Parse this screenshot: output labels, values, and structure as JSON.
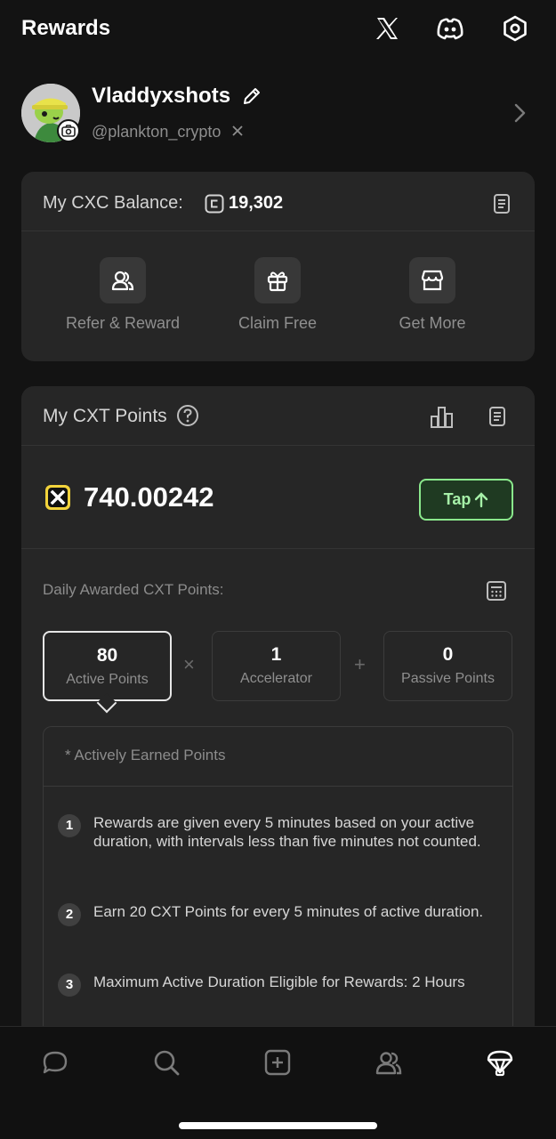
{
  "header": {
    "title": "Rewards",
    "icons": [
      "x-logo-icon",
      "discord-icon",
      "settings-hex-icon"
    ]
  },
  "profile": {
    "display_name": "Vladdyxshots",
    "handle": "@plankton_crypto"
  },
  "balance": {
    "label": "My CXC Balance:",
    "value": "19,302",
    "actions": [
      {
        "label": "Refer & Reward",
        "icon": "users-icon"
      },
      {
        "label": "Claim Free",
        "icon": "gift-icon"
      },
      {
        "label": "Get More",
        "icon": "store-icon"
      }
    ]
  },
  "points": {
    "title": "My CXT Points",
    "value": "740.00242",
    "tap_label": "Tap",
    "daily_label": "Daily Awarded CXT Points:",
    "metrics": [
      {
        "value": "80",
        "label": "Active Points"
      },
      {
        "value": "1",
        "label": "Accelerator"
      },
      {
        "value": "0",
        "label": "Passive Points"
      }
    ],
    "operators": [
      "×",
      "+"
    ],
    "info_title": "* Actively Earned Points",
    "rules": [
      {
        "num": "1",
        "text": "Rewards are given every 5 minutes based on your active duration, with intervals less than five minutes not counted."
      },
      {
        "num": "2",
        "text": "Earn 20 CXT Points for every 5 minutes of active duration."
      },
      {
        "num": "3",
        "text": "Maximum Active Duration Eligible for Rewards: 2 Hours"
      }
    ]
  },
  "nav": {
    "items": [
      "chat-icon",
      "search-icon",
      "create-icon",
      "community-icon",
      "rewards-icon"
    ],
    "active": "rewards-icon"
  },
  "colors": {
    "background": "#131313",
    "card": "#262626",
    "accent_green": "#8ae88c",
    "cxt_yellow": "#f2d33b"
  }
}
